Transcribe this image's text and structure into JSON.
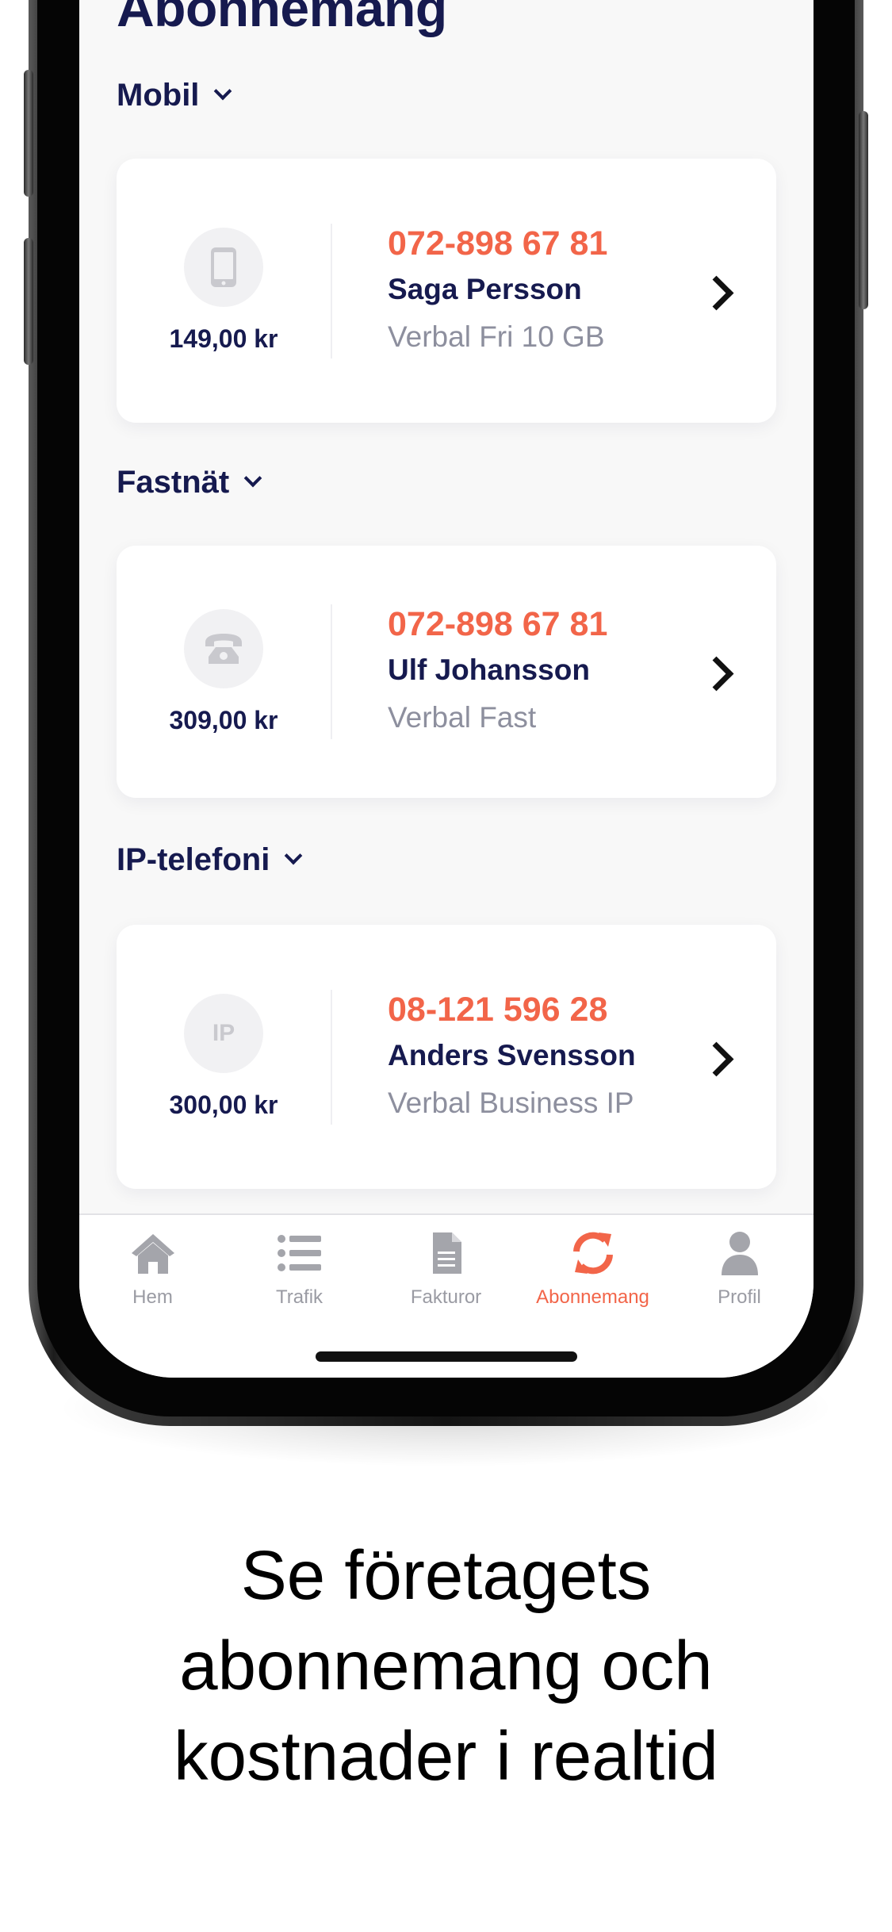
{
  "screen": {
    "title": "Abonnemang",
    "sections": [
      {
        "title": "Mobil",
        "card": {
          "icon": "mobile-phone-icon",
          "price": "149,00 kr",
          "number": "072-898 67 81",
          "name": "Saga Persson",
          "plan": "Verbal Fri 10 GB"
        }
      },
      {
        "title": "Fastnät",
        "card": {
          "icon": "landline-phone-icon",
          "price": "309,00 kr",
          "number": "072-898 67 81",
          "name": "Ulf Johansson",
          "plan": "Verbal Fast"
        }
      },
      {
        "title": "IP-telefoni",
        "card": {
          "icon": "ip-icon",
          "icon_text": "IP",
          "price": "300,00 kr",
          "number": "08-121 596 28",
          "name": "Anders Svensson",
          "plan": "Verbal Business IP"
        }
      }
    ]
  },
  "tabbar": {
    "active": "Abonnemang",
    "items": [
      {
        "label": "Hem",
        "icon": "home-icon"
      },
      {
        "label": "Trafik",
        "icon": "list-icon"
      },
      {
        "label": "Fakturor",
        "icon": "document-icon"
      },
      {
        "label": "Abonnemang",
        "icon": "refresh-icon"
      },
      {
        "label": "Profil",
        "icon": "user-icon"
      }
    ]
  },
  "caption": {
    "line1": "Se företagets",
    "line2": "abonnemang och",
    "line3": "kostnader i realtid"
  },
  "colors": {
    "accent": "#f26549",
    "navy": "#161a4f",
    "muted": "#8d8f9e",
    "tab_inactive": "#9a9ba3"
  }
}
